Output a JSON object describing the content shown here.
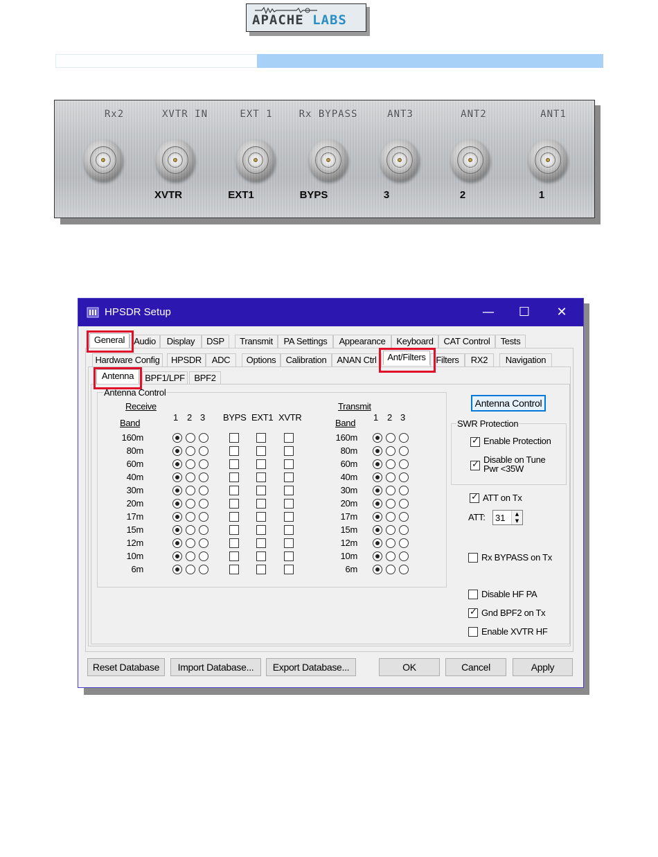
{
  "header": {
    "logo_main": "APACHE",
    "logo_accent": "LABS"
  },
  "panel": {
    "engraved_labels": [
      "Rx2",
      "XVTR IN",
      "EXT 1",
      "Rx BYPASS",
      "ANT3",
      "ANT2",
      "ANT1"
    ],
    "port_labels": [
      "",
      "XVTR",
      "EXT1",
      "BYPS",
      "3",
      "2",
      "1"
    ]
  },
  "window": {
    "title": "HPSDR Setup",
    "controls": {
      "minimize": "—",
      "maximize": "☐",
      "close": "✕"
    },
    "tabs_row1": [
      "General",
      "Audio",
      "Display",
      "DSP",
      "Transmit",
      "PA Settings",
      "Appearance",
      "Keyboard",
      "CAT Control",
      "Tests"
    ],
    "tabs_row2": [
      "Hardware Config",
      "HPSDR",
      "ADC",
      "Options",
      "Calibration",
      "ANAN Ctrl",
      "Ant/Filters",
      "Filters",
      "RX2",
      "Navigation"
    ],
    "tabs_row3": [
      "Antenna",
      "BPF1/LPF",
      "BPF2"
    ],
    "antenna_control": {
      "group_title": "Antenna Control",
      "receive_label": "Receive",
      "transmit_label": "Transmit",
      "band_label": "Band",
      "col_1": "1",
      "col_2": "2",
      "col_3": "3",
      "col_byps": "BYPS",
      "col_ext1": "EXT1",
      "col_xvtr": "XVTR",
      "bands": [
        "160m",
        "80m",
        "60m",
        "40m",
        "30m",
        "20m",
        "17m",
        "15m",
        "12m",
        "10m",
        "6m"
      ],
      "rx_selected": [
        1,
        1,
        1,
        1,
        1,
        1,
        1,
        1,
        1,
        1,
        1
      ],
      "tx_selected": [
        1,
        1,
        1,
        1,
        1,
        1,
        1,
        1,
        1,
        1,
        1
      ],
      "byps_checked": [
        false,
        false,
        false,
        false,
        false,
        false,
        false,
        false,
        false,
        false,
        false
      ],
      "ext1_checked": [
        false,
        false,
        false,
        false,
        false,
        false,
        false,
        false,
        false,
        false,
        false
      ],
      "xvtr_checked": [
        false,
        false,
        false,
        false,
        false,
        false,
        false,
        false,
        false,
        false,
        false
      ]
    },
    "right_panel": {
      "antenna_control_button": "Antenna Control",
      "swr_group_title": "SWR Protection",
      "enable_protection": {
        "label": "Enable Protection",
        "checked": true
      },
      "disable_on_tune": {
        "label_line1": "Disable on Tune",
        "label_line2": "Pwr <35W",
        "checked": true
      },
      "att_on_tx": {
        "label": "ATT on Tx",
        "checked": true
      },
      "att_label": "ATT:",
      "att_value": "31",
      "rx_bypass_on_tx": {
        "label": "Rx BYPASS on Tx",
        "checked": false
      },
      "disable_hf_pa": {
        "label": "Disable HF PA",
        "checked": false
      },
      "gnd_bpf2_on_tx": {
        "label": "Gnd BPF2 on Tx",
        "checked": true
      },
      "enable_xvtr_hf": {
        "label": "Enable XVTR HF",
        "checked": false
      }
    },
    "buttons": {
      "reset_database": "Reset Database",
      "import_database": "Import Database...",
      "export_database": "Export Database...",
      "ok": "OK",
      "cancel": "Cancel",
      "apply": "Apply"
    }
  }
}
